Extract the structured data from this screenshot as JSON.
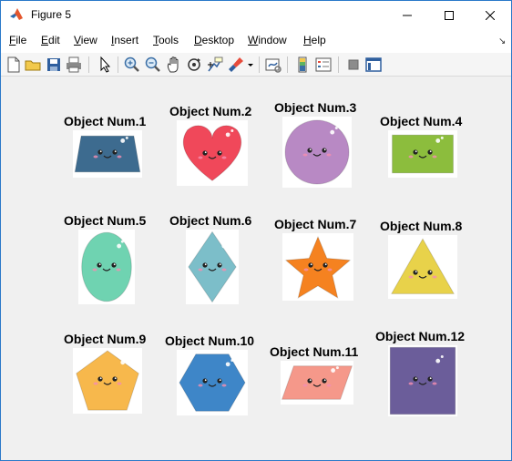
{
  "window": {
    "title": "Figure 5"
  },
  "menu": {
    "items": [
      "File",
      "Edit",
      "View",
      "Insert",
      "Tools",
      "Desktop",
      "Window",
      "Help"
    ]
  },
  "toolbar": {
    "tools": [
      "new-figure-icon",
      "open-file-icon",
      "save-icon",
      "print-icon",
      "edit-plot-arrow-icon",
      "zoom-in-icon",
      "zoom-out-icon",
      "pan-icon",
      "rotate-3d-icon",
      "data-cursor-icon",
      "brush-icon",
      "link-plot-icon",
      "colorbar-icon",
      "legend-icon",
      "hide-plot-tools-icon",
      "show-plot-tools-icon"
    ]
  },
  "objects": [
    {
      "label": "Object Num.1",
      "shape": "trapezoid",
      "color": "#3d6b8f"
    },
    {
      "label": "Object Num.2",
      "shape": "heart",
      "color": "#f0485a"
    },
    {
      "label": "Object Num.3",
      "shape": "circle",
      "color": "#b889c4"
    },
    {
      "label": "Object Num.4",
      "shape": "rectangle",
      "color": "#8cbd3d"
    },
    {
      "label": "Object Num.5",
      "shape": "ellipse",
      "color": "#6fd3b1"
    },
    {
      "label": "Object Num.6",
      "shape": "diamond",
      "color": "#7cbec9"
    },
    {
      "label": "Object Num.7",
      "shape": "star",
      "color": "#f58220"
    },
    {
      "label": "Object Num.8",
      "shape": "triangle",
      "color": "#e8d24a"
    },
    {
      "label": "Object Num.9",
      "shape": "pentagon",
      "color": "#f7b84c"
    },
    {
      "label": "Object Num.10",
      "shape": "hexagon",
      "color": "#3e86c8"
    },
    {
      "label": "Object Num.11",
      "shape": "parallelogram",
      "color": "#f5988a"
    },
    {
      "label": "Object Num.12",
      "shape": "square",
      "color": "#6b5d9a"
    }
  ]
}
